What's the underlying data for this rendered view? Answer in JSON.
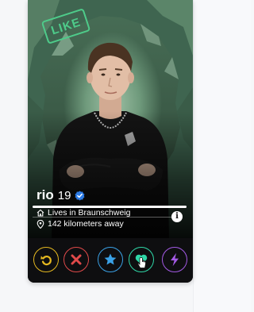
{
  "profile": {
    "stamp_label": "LIKE",
    "name": "rio",
    "age": "19",
    "lives_in": "Lives in Braunschweig",
    "distance": "142 kilometers away",
    "info_glyph": "i",
    "photo_index": 1,
    "photo_count": 1
  },
  "actions": [
    {
      "name": "rewind",
      "icon": "rewind-icon",
      "color": "#e5b820"
    },
    {
      "name": "nope",
      "icon": "close-icon",
      "color": "#e04a4a"
    },
    {
      "name": "super-like",
      "icon": "star-icon",
      "color": "#3aa1e6"
    },
    {
      "name": "like",
      "icon": "heart-icon",
      "color": "#2fd8a8"
    },
    {
      "name": "boost",
      "icon": "lightning-icon",
      "color": "#a45ae6"
    }
  ],
  "colors": {
    "stamp": "#4ecb8a",
    "verified": "#2c7be5"
  }
}
